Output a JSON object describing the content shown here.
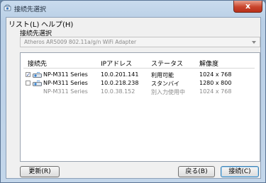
{
  "window": {
    "title": "接続先選択",
    "close_label": "x"
  },
  "menu": [
    {
      "label": "リスト(L)"
    },
    {
      "label": "ヘルプ(H)"
    }
  ],
  "adapter": {
    "section_label": "接続先選択",
    "selected": "Atheros AR5009 802.11a/g/n WiFi Adapter"
  },
  "table": {
    "headers": [
      "接続先",
      "IPアドレス",
      "ステータス",
      "解像度"
    ],
    "rows": [
      {
        "checked": true,
        "enabled": true,
        "name": "NP-M311 Series",
        "ip": "10.0.201.141",
        "status": "利用可能",
        "resolution": "1024 x 768"
      },
      {
        "checked": false,
        "enabled": true,
        "name": "NP-M311 Series",
        "ip": "10.0.218.238",
        "status": "スタンバイ",
        "resolution": "1280 x 800"
      },
      {
        "checked": false,
        "enabled": false,
        "name": "NP-M311 Series",
        "ip": "10.0.38.152",
        "status": "別入力使用中",
        "resolution": "1024 x 768"
      }
    ]
  },
  "buttons": {
    "refresh": "更新(R)",
    "back": "戻る(B)",
    "connect": "接続(C)"
  },
  "icons": {
    "app": "network-app-icon",
    "projector": "projector-icon"
  }
}
